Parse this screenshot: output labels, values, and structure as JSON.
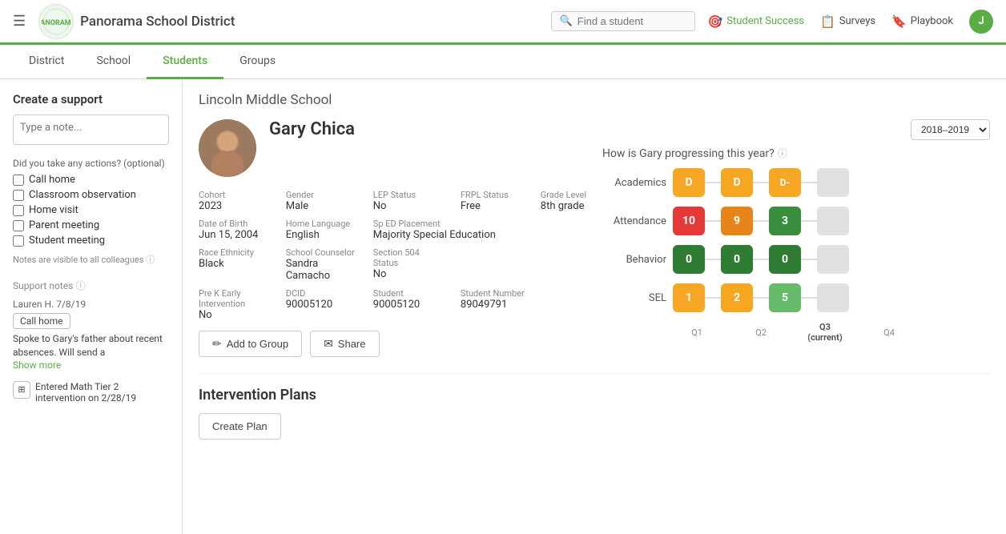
{
  "nav": {
    "hamburger": "☰",
    "logo_text": "Panorama School District",
    "search_placeholder": "Find a student",
    "links": [
      {
        "label": "Student Success",
        "icon": "🎯",
        "active": false
      },
      {
        "label": "Surveys",
        "icon": "📋",
        "active": false
      },
      {
        "label": "Playbook",
        "icon": "🔖",
        "active": false
      }
    ],
    "avatar_initial": "J"
  },
  "secondary_nav": {
    "items": [
      {
        "label": "District",
        "active": false
      },
      {
        "label": "School",
        "active": false
      },
      {
        "label": "Students",
        "active": true
      },
      {
        "label": "Groups",
        "active": false
      }
    ]
  },
  "sidebar": {
    "create_support_title": "Create a support",
    "note_placeholder": "Type a note...",
    "actions_label": "Did you take any actions? (optional)",
    "actions": [
      {
        "label": "Call home"
      },
      {
        "label": "Classroom observation"
      },
      {
        "label": "Home visit"
      },
      {
        "label": "Parent meeting"
      },
      {
        "label": "Student meeting"
      }
    ],
    "visible_note": "Notes are visible to all colleagues",
    "support_notes_title": "Support notes",
    "notes": [
      {
        "meta": "Lauren H. 7/8/19",
        "tag": "Call home",
        "text": "Spoke to Gary's father about recent absences. Will send a",
        "show_more": "Show more"
      }
    ],
    "note2_text": "Entered Math Tier 2 intervention on 2/28/19"
  },
  "content": {
    "school_name": "Lincoln Middle School",
    "student": {
      "name": "Gary Chica",
      "details": [
        {
          "label": "Cohort",
          "value": "2023"
        },
        {
          "label": "Gender",
          "value": "Male"
        },
        {
          "label": "LEP Status",
          "value": "No"
        },
        {
          "label": "FRPL Status",
          "value": "Free"
        },
        {
          "label": "Grade Level",
          "value": "8th grade"
        },
        {
          "label": "Date of Birth",
          "value": "Jun 15, 2004"
        },
        {
          "label": "Home Language",
          "value": "English"
        },
        {
          "label": "Sp ED Placement",
          "value": "Majority Special Education"
        },
        {
          "label": "",
          "value": ""
        },
        {
          "label": "",
          "value": ""
        },
        {
          "label": "Race Ethnicity",
          "value": "Black"
        },
        {
          "label": "School Counselor",
          "value": "Sandra Camacho"
        },
        {
          "label": "Section 504 Status",
          "value": "No"
        },
        {
          "label": "",
          "value": ""
        },
        {
          "label": "",
          "value": ""
        },
        {
          "label": "Pre K Early Intervention",
          "value": "No"
        },
        {
          "label": "DCID",
          "value": "90005120"
        },
        {
          "label": "Student",
          "value": "90005120"
        },
        {
          "label": "Student Number",
          "value": "89049791"
        },
        {
          "label": "",
          "value": ""
        }
      ]
    },
    "year_label": "2018–2019",
    "progress_title": "How is Gary progressing this year?",
    "chart": {
      "rows": [
        {
          "label": "Academics",
          "dots": [
            {
              "value": "D",
              "color": "yellow"
            },
            {
              "value": "D",
              "color": "yellow"
            },
            {
              "value": "D-",
              "color": "yellow"
            },
            {
              "value": "",
              "color": "empty"
            }
          ]
        },
        {
          "label": "Attendance",
          "dots": [
            {
              "value": "10",
              "color": "red"
            },
            {
              "value": "9",
              "color": "orange"
            },
            {
              "value": "3",
              "color": "green-med"
            },
            {
              "value": "",
              "color": "empty"
            }
          ]
        },
        {
          "label": "Behavior",
          "dots": [
            {
              "value": "0",
              "color": "green-dark"
            },
            {
              "value": "0",
              "color": "green-dark"
            },
            {
              "value": "0",
              "color": "green-dark"
            },
            {
              "value": "",
              "color": "empty"
            }
          ]
        },
        {
          "label": "SEL",
          "dots": [
            {
              "value": "1",
              "color": "yellow"
            },
            {
              "value": "2",
              "color": "yellow"
            },
            {
              "value": "5",
              "color": "green-light"
            },
            {
              "value": "",
              "color": "empty"
            }
          ]
        }
      ],
      "quarters": [
        "Q1",
        "Q2",
        "Q3\n(current)",
        "Q4"
      ]
    },
    "buttons": [
      {
        "label": "Add to Group",
        "icon": "✏"
      },
      {
        "label": "Share",
        "icon": "✉"
      }
    ],
    "intervention": {
      "title": "Intervention Plans",
      "create_label": "Create Plan"
    }
  }
}
